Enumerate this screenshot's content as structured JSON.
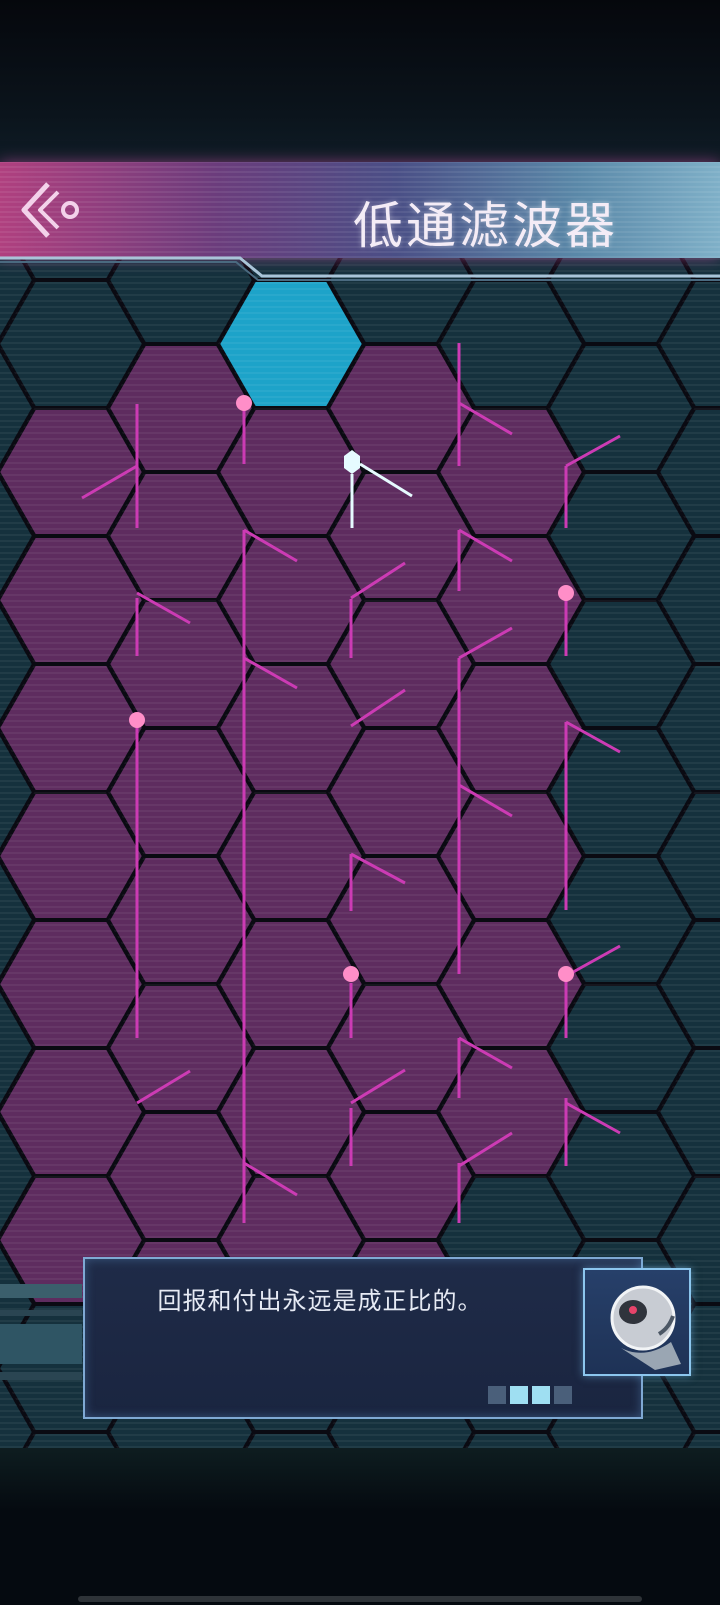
{
  "header": {
    "title": "低通滤波器",
    "back_icon": "back-chevron-icon"
  },
  "dialog": {
    "text": "回报和付出永远是成正比的。",
    "pages_total": 4,
    "pages_active": [
      1,
      2
    ],
    "avatar_icon": "robot-head-icon"
  },
  "colors": {
    "header_accent": "#b0407f",
    "tile_purple": "#5e2c5f",
    "tile_teal": "#15313d",
    "wire": "#cc3bb4",
    "node": "#ff8ec8",
    "active_tile": "#1da3c9",
    "active_beam": "#e6fbff"
  },
  "board": {
    "active_tile": "power-source-tile"
  }
}
